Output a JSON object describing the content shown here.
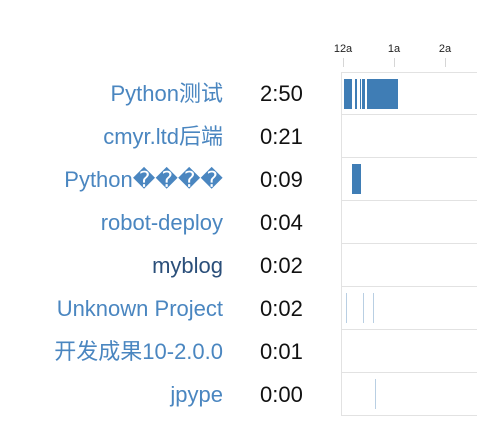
{
  "axis": {
    "ticks": [
      {
        "label": "12a",
        "hour": 0
      },
      {
        "label": "1a",
        "hour": 1
      },
      {
        "label": "2a",
        "hour": 2
      }
    ]
  },
  "colors": {
    "link": "#4a86c0",
    "link_visited": "#2b4f7a",
    "text": "#111111",
    "bar": "#3f7db5",
    "bar_faint": "#b9cfe3",
    "grid": "#e2e2e2"
  },
  "projects": [
    {
      "name": "Python测试",
      "duration": "2:50",
      "style": "link",
      "segments": [
        {
          "start": 0.0,
          "end": 0.16
        },
        {
          "start": 0.21,
          "end": 0.26
        },
        {
          "start": 0.31,
          "end": 0.33
        },
        {
          "start": 0.36,
          "end": 0.42
        },
        {
          "start": 0.46,
          "end": 1.06
        }
      ]
    },
    {
      "name": "cmyr.ltd后端",
      "duration": "0:21",
      "style": "link",
      "segments": []
    },
    {
      "name": "Python����",
      "duration": "0:09",
      "style": "link",
      "segments": [
        {
          "start": 0.16,
          "end": 0.33
        }
      ]
    },
    {
      "name": "robot-deploy",
      "duration": "0:04",
      "style": "link",
      "segments": []
    },
    {
      "name": "myblog",
      "duration": "0:02",
      "style": "link_visited",
      "segments": []
    },
    {
      "name": "Unknown Project",
      "duration": "0:02",
      "style": "link",
      "segments": [
        {
          "start": 0.03,
          "end": 0.05,
          "faint": true
        },
        {
          "start": 0.38,
          "end": 0.4,
          "faint": true
        },
        {
          "start": 0.56,
          "end": 0.58,
          "faint": true
        }
      ]
    },
    {
      "name": "开发成果10-2.0.0",
      "duration": "0:01",
      "style": "link",
      "segments": []
    },
    {
      "name": "jpype",
      "duration": "0:00",
      "style": "link",
      "segments": [
        {
          "start": 0.61,
          "end": 0.63,
          "faint": true
        }
      ]
    }
  ]
}
